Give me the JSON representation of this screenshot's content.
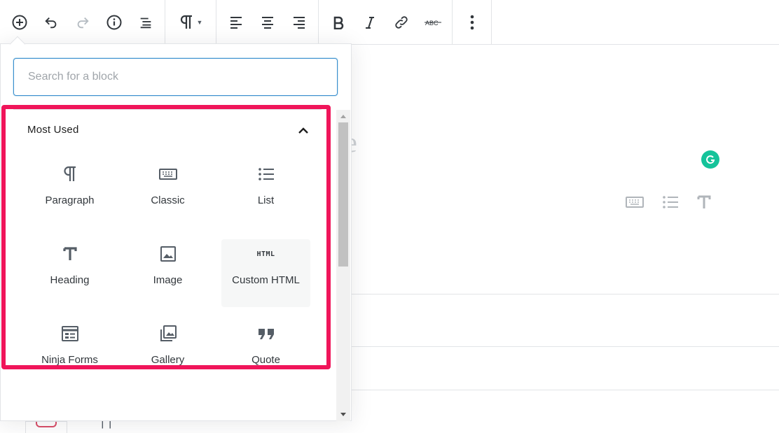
{
  "toolbar": {
    "buttons": {
      "add": "add-block",
      "undo": "undo",
      "redo": "redo",
      "info": "content-structure",
      "outline": "block-navigation",
      "paragraph": "change-block-type",
      "align_left": "align-left",
      "align_center": "align-center",
      "align_right": "align-right",
      "bold": "bold",
      "italic": "italic",
      "link": "link",
      "strikethrough": "strikethrough",
      "more": "more-options"
    }
  },
  "inserter": {
    "search_placeholder": "Search for a block",
    "panel_title": "Most Used",
    "blocks": [
      {
        "label": "Paragraph",
        "icon": "paragraph-icon"
      },
      {
        "label": "Classic",
        "icon": "keyboard-icon"
      },
      {
        "label": "List",
        "icon": "list-icon"
      },
      {
        "label": "Heading",
        "icon": "heading-icon"
      },
      {
        "label": "Image",
        "icon": "image-icon"
      },
      {
        "label": "Custom HTML",
        "icon": "html-icon",
        "icon_text": "HTML"
      },
      {
        "label": "Ninja Forms",
        "icon": "form-icon"
      },
      {
        "label": "Gallery",
        "icon": "gallery-icon"
      },
      {
        "label": "Quote",
        "icon": "quote-icon"
      }
    ]
  },
  "colors": {
    "highlight": "#f0155a",
    "focus": "#3c8fcf",
    "grammarly": "#15c39a",
    "icon": "#555d66"
  },
  "strike_icon_text": "ABC"
}
